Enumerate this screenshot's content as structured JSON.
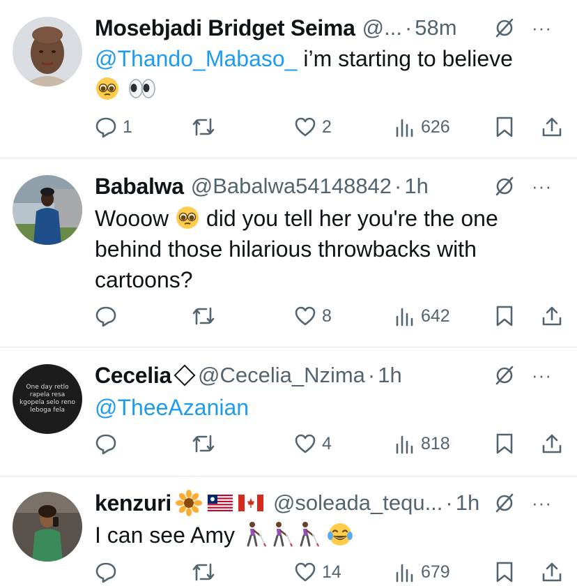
{
  "tweets": [
    {
      "name": "Mosebjadi Bridget Seima",
      "handle": "@...",
      "time": "58m",
      "mention": "@Thando_Mabaso_",
      "text": " i’m starting to believe",
      "emojis": [
        "pleading-face",
        "eyes"
      ],
      "replies": "1",
      "retweets": "",
      "likes": "2",
      "views": "626"
    },
    {
      "name": "Babalwa",
      "handle": "@Babalwa54148842",
      "time": "1h",
      "text_before_emoji": "Wooow ",
      "emojis": [
        "pleading-face"
      ],
      "text_after_emoji": " did you tell her you're the one behind those hilarious throwbacks with cartoons?",
      "replies": "",
      "retweets": "",
      "likes": "8",
      "views": "642"
    },
    {
      "name": "Cecelia",
      "handle": "@Cecelia_Nzima",
      "time": "1h",
      "mention": "@TheeAzanian",
      "avatar_text": "One day retlo rapela resa kgopela selo reno leboga fela",
      "replies": "",
      "retweets": "",
      "likes": "4",
      "views": "818"
    },
    {
      "name": "kenzuri",
      "name_emojis": [
        "sunflower",
        "liberia-flag",
        "canada-flag"
      ],
      "handle": "@soleada_tequ...",
      "time": "1h",
      "text": "I can see Amy ",
      "emojis": [
        "person-with-white-cane",
        "person-with-white-cane",
        "person-with-white-cane",
        "face-with-tears-of-joy"
      ],
      "replies": "",
      "retweets": "",
      "likes": "14",
      "views": "679"
    }
  ],
  "separator_dot": "·",
  "more_glyph": "···",
  "colors": {
    "text": "#0f1419",
    "secondary": "#536471",
    "mention": "#1d9bf0",
    "divider": "#e6e9ec"
  }
}
